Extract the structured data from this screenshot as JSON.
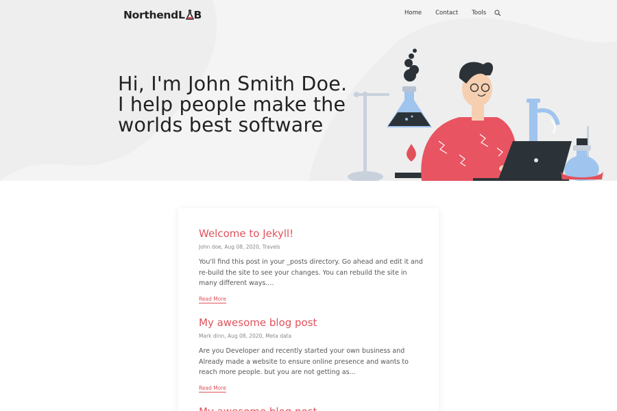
{
  "header": {
    "logo_text": "Northend",
    "logo_suffix_l": "L",
    "logo_suffix_b": "B",
    "nav": [
      {
        "label": "Home"
      },
      {
        "label": "Contact"
      },
      {
        "label": "Tools"
      }
    ]
  },
  "hero": {
    "lines": [
      "Hi, I'm John Smith Doe.",
      "I help people make the",
      "worlds best software"
    ]
  },
  "posts": [
    {
      "title": "Welcome to Jekyll!",
      "meta": "John doe, Aug 08, 2020, Travels",
      "excerpt": "You'll find this post in your _posts directory. Go ahead and edit it and re-build the site to see your changes. You can rebuild the site in many different ways....",
      "read_more": "Read More"
    },
    {
      "title": "My awesome blog post",
      "meta": "Mark dinn, Aug 08, 2020, Meta data",
      "excerpt": "Are you Developer and recently started your own business and Already made a website to ensure online presence and wants to reach more people. but you are not getting as...",
      "read_more": "Read More"
    },
    {
      "title": "My awesome blog post"
    }
  ],
  "colors": {
    "accent": "#e2525b",
    "hero_bg": "#f4f4f4"
  }
}
